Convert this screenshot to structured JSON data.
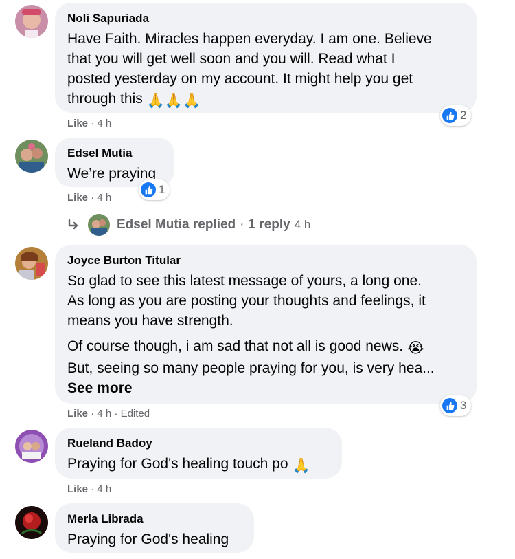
{
  "comments": [
    {
      "author": "Noli Sapuriada",
      "text": "Have Faith. Miracles happen everyday. I am one. Believe\nthat you will get well soon and you will. Read what I\nposted yesterday on my account. It might help you get\nthrough this",
      "emoji": "🙏🙏🙏",
      "like_label": "Like",
      "time": "4 h",
      "reaction_count": "2"
    },
    {
      "author": "Edsel Mutia",
      "text": "We’re praying",
      "like_label": "Like",
      "time": "4 h",
      "reaction_count": "1",
      "reply": {
        "name": "Edsel Mutia replied",
        "count": "1 reply",
        "time": "4 h"
      }
    },
    {
      "author": "Joyce Burton Titular",
      "text": "So glad to see this latest message of yours, a long one.\nAs long as you are posting your thoughts and feelings, it\nmeans you have strength.",
      "text2": "Of course though, i am sad that not all is good news.",
      "emoji2": "😭",
      "text3": "But, seeing so many people praying for you, is very hea...",
      "see_more": "See more",
      "like_label": "Like",
      "time": "4 h",
      "edited": "Edited",
      "reaction_count": "3"
    },
    {
      "author": "Rueland Badoy",
      "text": "Praying for God's healing touch po",
      "emoji": "🙏",
      "like_label": "Like",
      "time": "4 h"
    },
    {
      "author": "Merla Librada",
      "text": "Praying for God's healing"
    }
  ],
  "colors": {
    "bubble": "#f0f2f5",
    "meta": "#65676b",
    "like_blue": "#1877f2"
  },
  "icons": {
    "reaction": "thumbs-up-icon",
    "reply": "reply-arrow-icon"
  }
}
